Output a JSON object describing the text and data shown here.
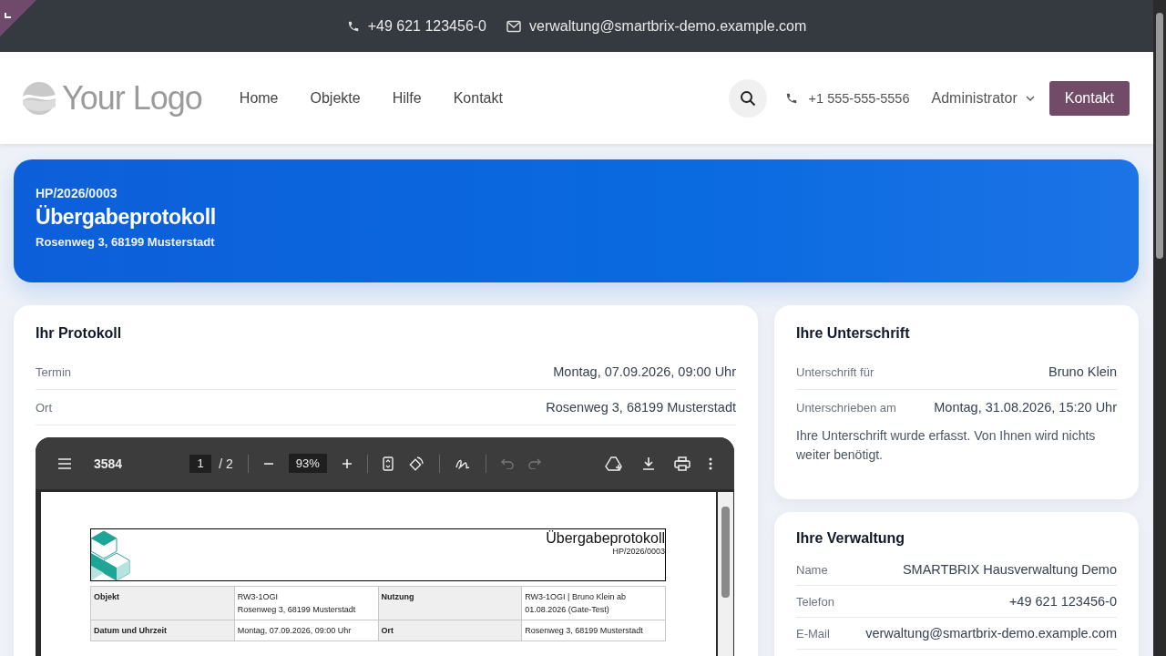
{
  "topbar": {
    "phone": "+49 621 123456-0",
    "email": "verwaltung@smartbrix-demo.example.com"
  },
  "header": {
    "logo": "Your Logo",
    "nav": [
      {
        "label": "Home"
      },
      {
        "label": "Objekte"
      },
      {
        "label": "Hilfe"
      },
      {
        "label": "Kontakt"
      }
    ],
    "phone": "+1 555-555-5556",
    "user": "Administrator",
    "cta": "Kontakt"
  },
  "hero": {
    "number": "HP/2026/0003",
    "title": "Übergabeprotokoll",
    "address": "Rosenweg 3, 68199 Musterstadt"
  },
  "protocol": {
    "title": "Ihr Protokoll",
    "rows": [
      {
        "label": "Termin",
        "value": "Montag, 07.09.2026, 09:00 Uhr"
      },
      {
        "label": "Ort",
        "value": "Rosenweg 3, 68199 Musterstadt"
      }
    ],
    "viewer": {
      "name": "3584",
      "page": "1",
      "pages": "/ 2",
      "zoom": "93%",
      "undo_disabled": true,
      "redo_disabled": true,
      "document": {
        "title": "Übergabeprotokoll",
        "number": "HP/2026/0003",
        "rows": [
          [
            {
              "label": "Objekt",
              "value": "RW3-1OGI\nRosenweg 3, 68199 Musterstadt"
            },
            {
              "label": "Nutzung",
              "value": "RW3-1OGI | Bruno Klein ab 01.08.2026 (Gate-Test)"
            }
          ],
          [
            {
              "label": "Datum und Uhrzeit",
              "value": "Montag, 07.09.2026, 09:00 Uhr"
            },
            {
              "label": "Ort",
              "value": "Rosenweg 3, 68199 Musterstadt"
            }
          ]
        ]
      }
    }
  },
  "signature": {
    "title": "Ihre Unterschrift",
    "rows": [
      {
        "label": "Unterschrift für",
        "value": "Bruno Klein"
      },
      {
        "label": "Unterschrieben am",
        "value": "Montag, 31.08.2026, 15:20 Uhr"
      }
    ],
    "note": "Ihre Unterschrift wurde erfasst. Von Ihnen wird nichts weiter benötigt."
  },
  "management": {
    "title": "Ihre Verwaltung",
    "rows": [
      {
        "label": "Name",
        "value": "SMARTBRIX Hausverwaltung Demo"
      },
      {
        "label": "Telefon",
        "value": "+49 621 123456-0"
      },
      {
        "label": "E-Mail",
        "value": "verwaltung@smartbrix-demo.example.com"
      }
    ]
  }
}
